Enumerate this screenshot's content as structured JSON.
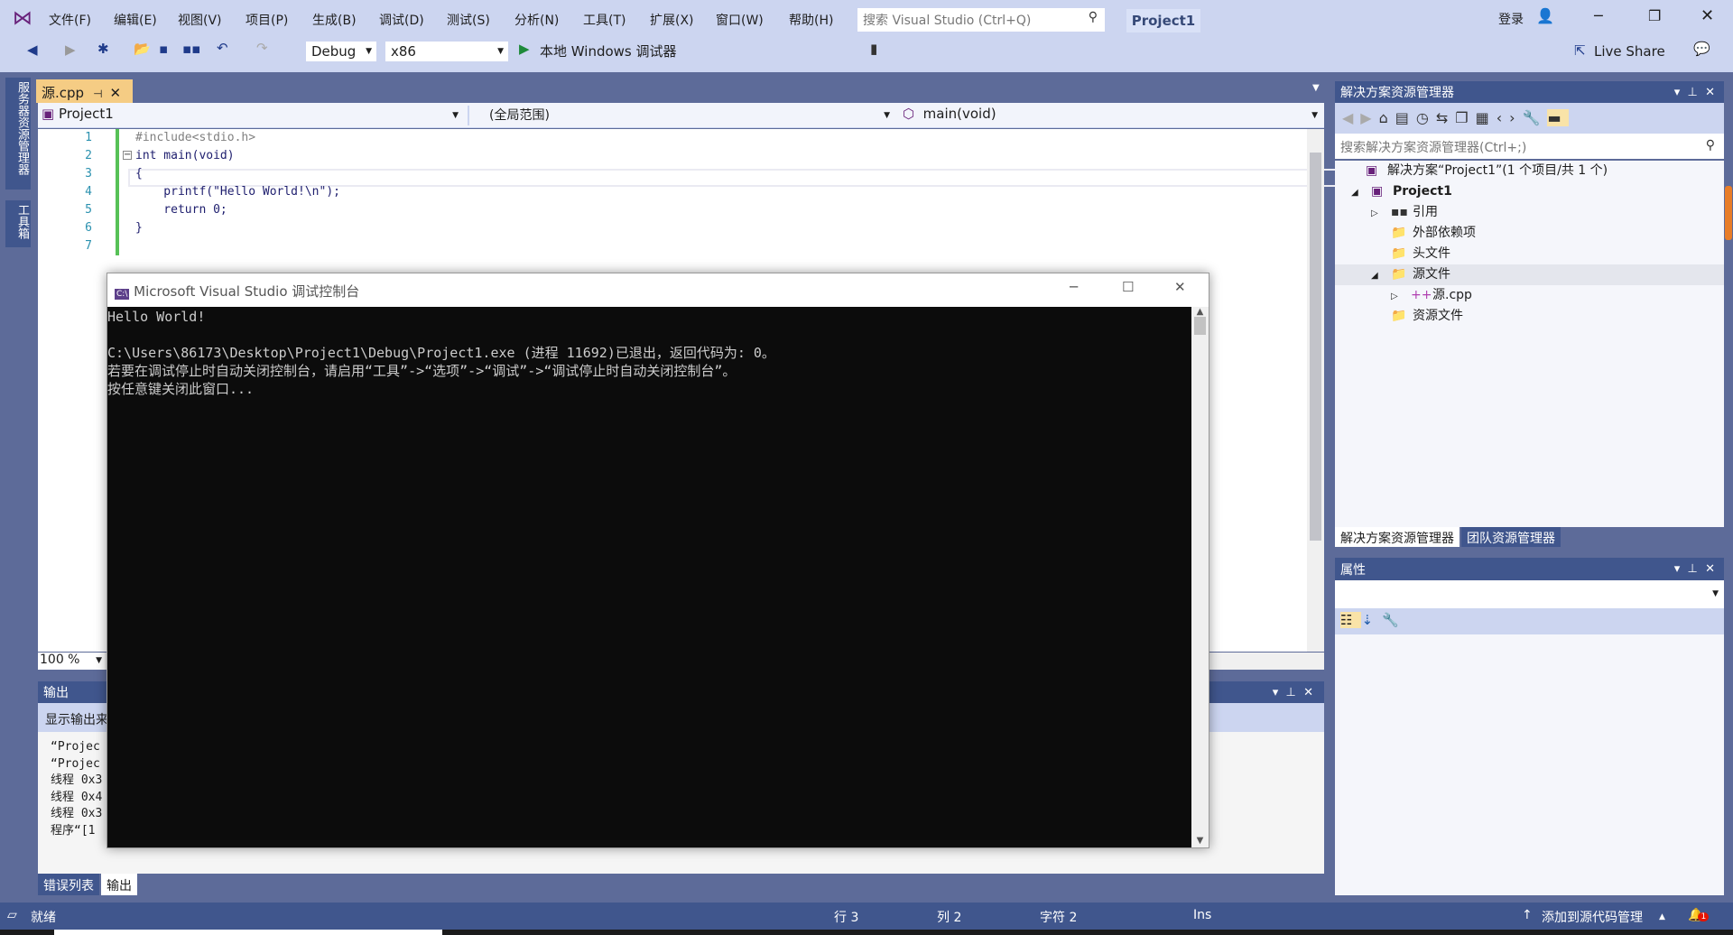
{
  "menu": [
    "文件(F)",
    "编辑(E)",
    "视图(V)",
    "项目(P)",
    "生成(B)",
    "调试(D)",
    "测试(S)",
    "分析(N)",
    "工具(T)",
    "扩展(X)",
    "窗口(W)",
    "帮助(H)"
  ],
  "search_placeholder": "搜索 Visual Studio (Ctrl+Q)",
  "project_badge": "Project1",
  "login": "登录",
  "toolbar": {
    "config": "Debug",
    "platform": "x86",
    "run": "本地 Windows 调试器",
    "live_share": "Live Share"
  },
  "left_tabs": [
    "服务器资源管理器",
    "工具箱"
  ],
  "editor": {
    "tab": "源.cpp",
    "nav_project": "Project1",
    "nav_scope": "(全局范围)",
    "nav_member": "main(void)",
    "zoom": "100 %",
    "lines": [
      "1",
      "2",
      "3",
      "4",
      "5",
      "6",
      "7"
    ],
    "code": [
      "#include<stdio.h>",
      "int main(void)",
      "{",
      "    printf(\"Hello World!\\n\");",
      "    return 0;",
      "}",
      ""
    ]
  },
  "console": {
    "title": "Microsoft Visual Studio 调试控制台",
    "lines": [
      "Hello World!",
      "",
      "C:\\Users\\86173\\Desktop\\Project1\\Debug\\Project1.exe (进程 11692)已退出，返回代码为: 0。",
      "若要在调试停止时自动关闭控制台，请启用“工具”->“选项”->“调试”->“调试停止时自动关闭控制台”。",
      "按任意键关闭此窗口..."
    ]
  },
  "output": {
    "title": "输出",
    "show_from": "显示输出来",
    "lines": [
      "“Projec",
      "“Projec",
      "线程 0x3",
      "线程 0x4",
      "线程 0x3",
      "程序“[1"
    ],
    "tabs": [
      "错误列表",
      "输出"
    ]
  },
  "solution": {
    "title": "解决方案资源管理器",
    "search_placeholder": "搜索解决方案资源管理器(Ctrl+;)",
    "items": [
      "解决方案“Project1”(1 个项目/共 1 个)",
      "Project1",
      "引用",
      "外部依赖项",
      "头文件",
      "源文件",
      "源.cpp",
      "资源文件"
    ],
    "tabs": [
      "解决方案资源管理器",
      "团队资源管理器"
    ]
  },
  "properties": {
    "title": "属性"
  },
  "status": {
    "ready": "就绪",
    "line": "行 3",
    "col": "列 2",
    "char": "字符 2",
    "ins": "Ins",
    "source_control": "添加到源代码管理",
    "notifications": "1"
  },
  "colors": {
    "accent": "#40568d",
    "tab_active": "#f5cc84",
    "console_bg": "#0c0c0c"
  }
}
